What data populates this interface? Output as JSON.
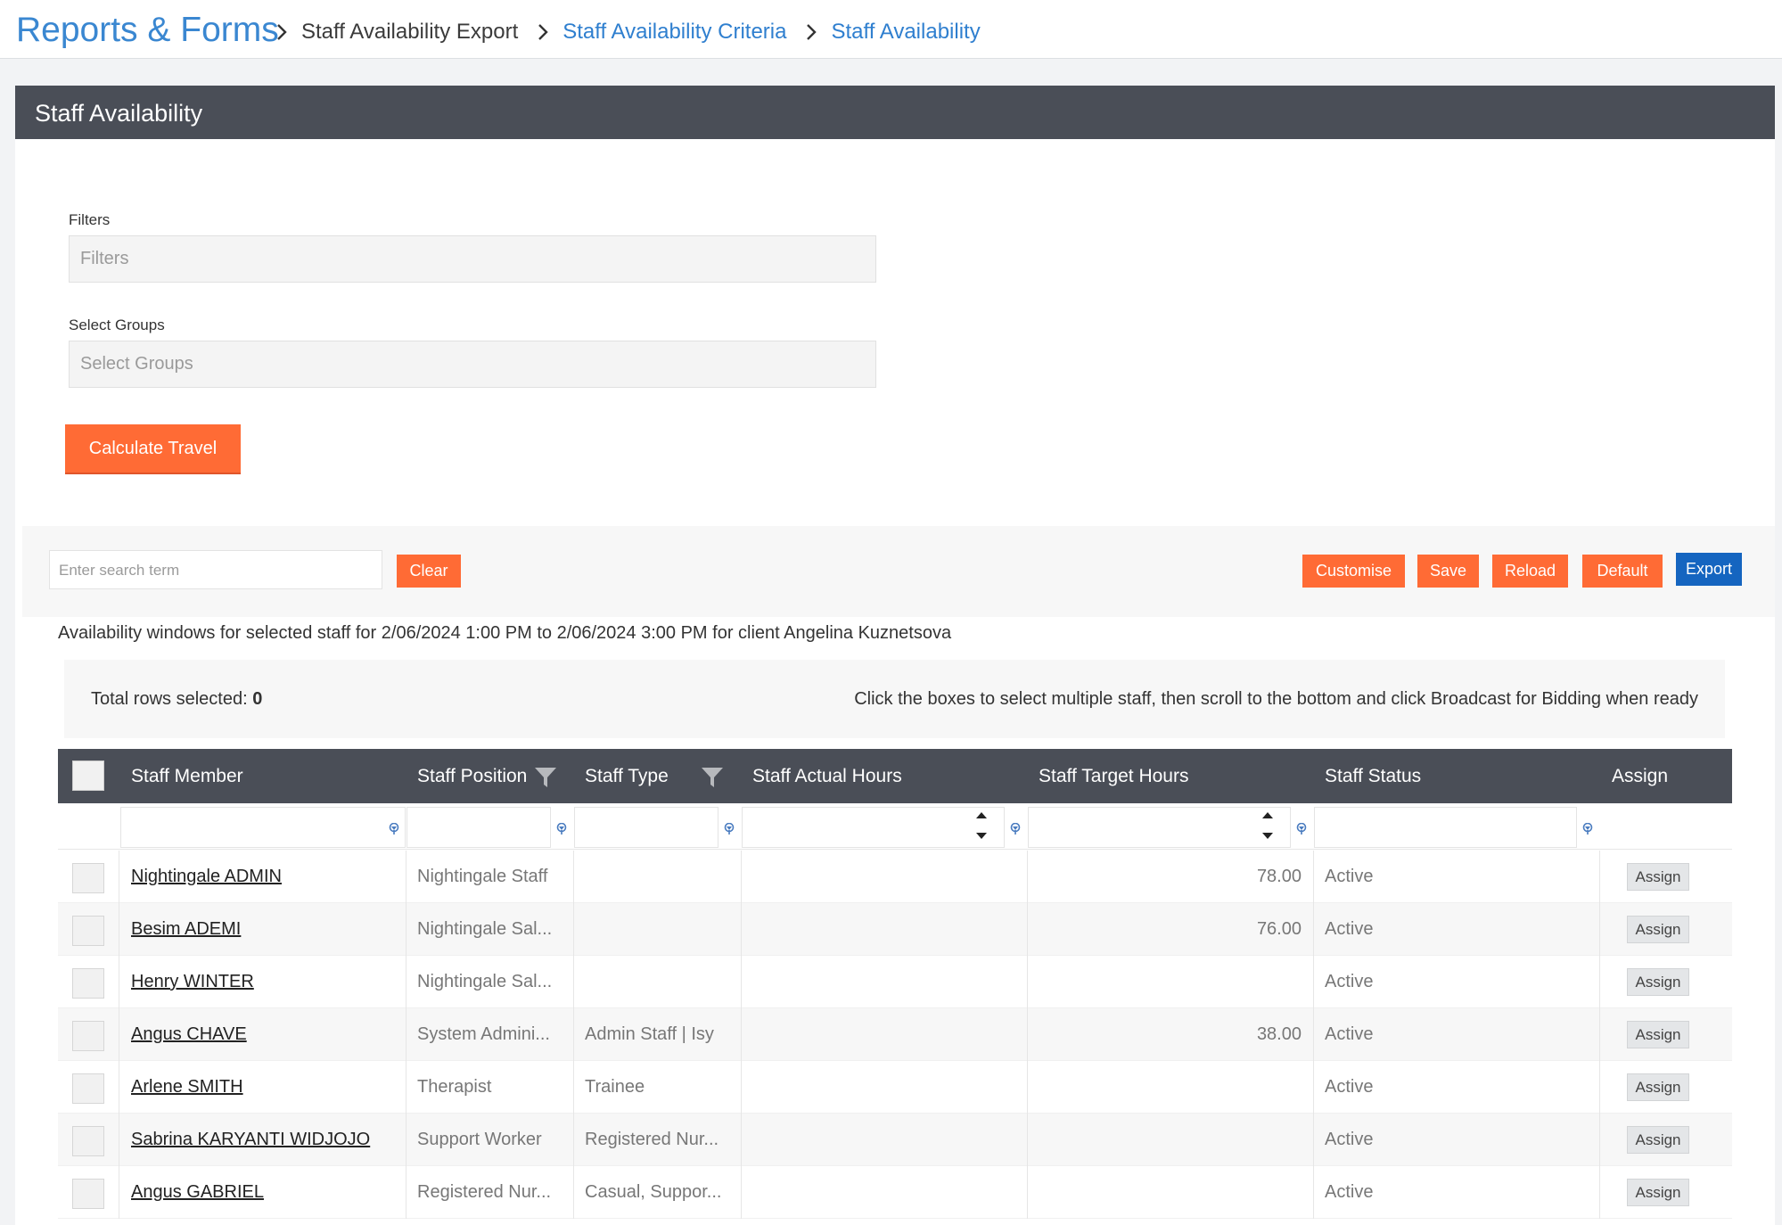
{
  "header": {
    "brand": "Reports & Forms",
    "breadcrumbs": [
      {
        "label": "Staff Availability Export"
      },
      {
        "label": "Staff Availability Criteria"
      },
      {
        "label": "Staff Availability"
      }
    ]
  },
  "panel": {
    "title": "Staff Availability",
    "filters_label": "Filters",
    "filters_placeholder": "Filters",
    "groups_label": "Select Groups",
    "groups_placeholder": "Select Groups",
    "calculate_button": "Calculate Travel"
  },
  "toolbar": {
    "search_placeholder": "Enter search term",
    "clear_button": "Clear",
    "customise_button": "Customise",
    "save_button": "Save",
    "reload_button": "Reload",
    "default_button": "Default",
    "export_button": "Export"
  },
  "info_text": "Availability windows for selected staff for 2/06/2024 1:00 PM to 2/06/2024 3:00 PM for client Angelina Kuznetsova",
  "selection": {
    "total_label": "Total rows selected:",
    "total_value": "0",
    "hint": "Click the boxes to select multiple staff, then scroll to the bottom and click Broadcast for Bidding when ready"
  },
  "grid": {
    "columns": [
      "Staff Member",
      "Staff Position",
      "Staff Type",
      "Staff Actual Hours",
      "Staff Target Hours",
      "Staff Status",
      "Assign"
    ],
    "rows": [
      {
        "member": "Nightingale ADMIN",
        "position": "Nightingale Staff",
        "type": "",
        "actual": "",
        "target": "78.00",
        "status": "Active",
        "assign": "Assign"
      },
      {
        "member": "Besim ADEMI",
        "position": "Nightingale Sal...",
        "type": "",
        "actual": "",
        "target": "76.00",
        "status": "Active",
        "assign": "Assign"
      },
      {
        "member": "Henry WINTER",
        "position": "Nightingale Sal...",
        "type": "",
        "actual": "",
        "target": "",
        "status": "Active",
        "assign": "Assign"
      },
      {
        "member": "Angus CHAVE",
        "position": "System Admini...",
        "type": "Admin Staff | Isy",
        "actual": "",
        "target": "38.00",
        "status": "Active",
        "assign": "Assign"
      },
      {
        "member": "Arlene SMITH",
        "position": "Therapist",
        "type": "Trainee",
        "actual": "",
        "target": "",
        "status": "Active",
        "assign": "Assign"
      },
      {
        "member": "Sabrina KARYANTI WIDJOJO",
        "position": "Support Worker",
        "type": "Registered Nur...",
        "actual": "",
        "target": "",
        "status": "Active",
        "assign": "Assign"
      },
      {
        "member": "Angus GABRIEL",
        "position": "Registered Nur...",
        "type": "Casual, Suppor...",
        "actual": "",
        "target": "",
        "status": "Active",
        "assign": "Assign"
      }
    ]
  },
  "colors": {
    "accent_orange": "#ff6b35",
    "export_blue": "#1565c0",
    "header_dark": "#4a4e57",
    "link_blue": "#2f7fcf"
  }
}
